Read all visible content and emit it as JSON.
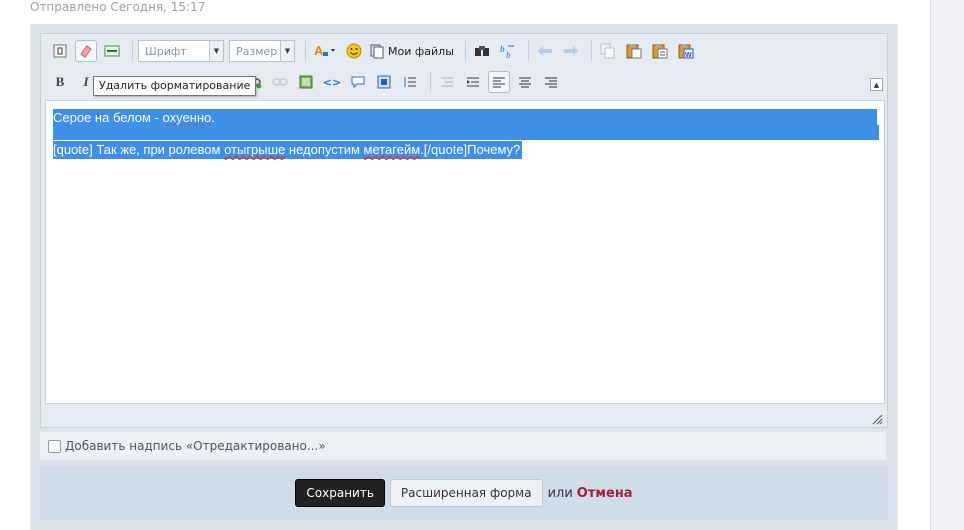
{
  "post": {
    "sent_text": "Отправлено Сегодня, 15:17"
  },
  "toolbar": {
    "font_select": "Шрифт",
    "size_select": "Размер",
    "my_files_label": "Мои файлы",
    "bold": "B",
    "italic": "I",
    "tooltip": "Удалить форматирование"
  },
  "editor": {
    "line1_prefix": "Серое на белом - ",
    "line1_word": "охуенно",
    "line1_suffix": ".",
    "line2_prefix": "[quote] Так же, при ролевом ",
    "line2_w1": "отыгрыше",
    "line2_mid": " недопустим ",
    "line2_w2": "метагейм",
    "line2_suffix": ".[/quote]Почему?"
  },
  "form": {
    "edited_checkbox_label": "Добавить надпись «Отредактировано...»",
    "edited_checked": false,
    "save_label": "Сохранить",
    "extended_label": "Расширенная форма",
    "or_label": "или",
    "cancel_label": "Отмена"
  },
  "colors": {
    "selection": "#3d8fe7",
    "cancel": "#a4232a"
  }
}
